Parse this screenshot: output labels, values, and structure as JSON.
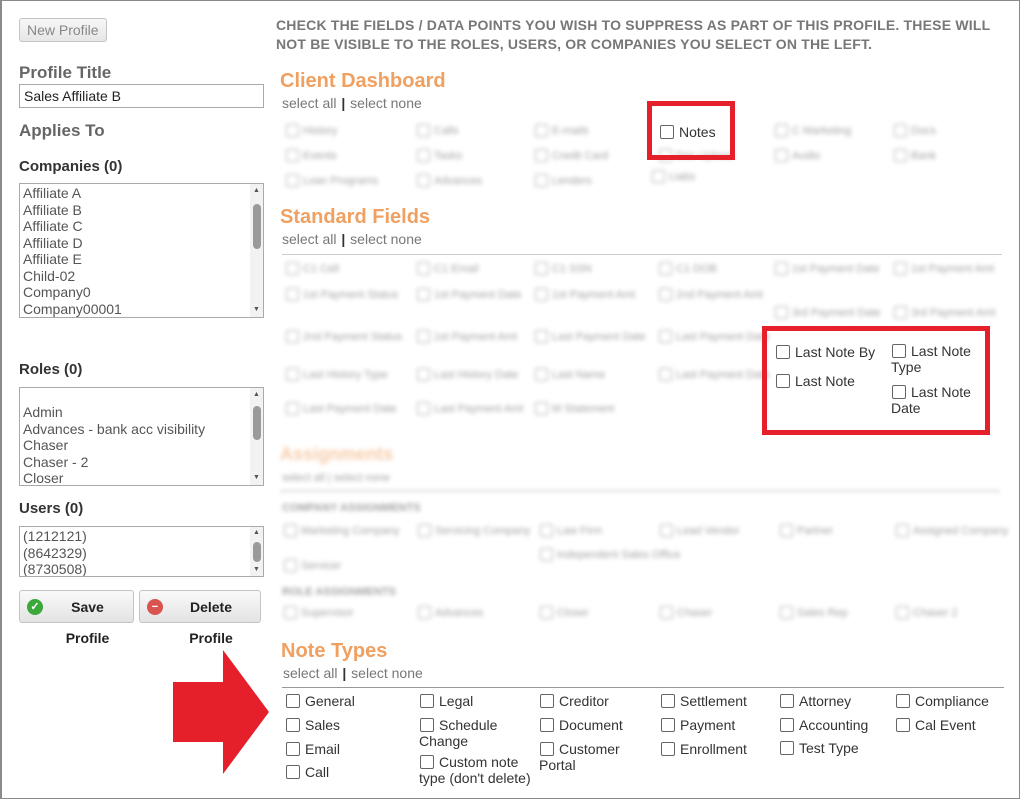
{
  "left": {
    "new_profile_label": "New Profile",
    "profile_title_label": "Profile Title",
    "profile_title_value": "Sales Affiliate B",
    "applies_to_label": "Applies To",
    "companies_label": "Companies (0)",
    "companies": [
      "Affiliate A",
      "Affiliate B",
      "Affiliate C",
      "Affiliate D",
      "Affiliate E",
      "Child-02",
      "Company0",
      "Company00001"
    ],
    "roles_label": "Roles (0)",
    "roles": [
      "Admin",
      "Advances - bank acc visibility",
      "Chaser",
      "Chaser - 2",
      "Closer"
    ],
    "users_label": "Users (0)",
    "users": [
      "(1212121)",
      "(8642329)",
      "(8730508)"
    ],
    "save_label": "Save Profile",
    "delete_label": "Delete Profile"
  },
  "instructions": "CHECK THE FIELDS / DATA POINTS YOU WISH TO SUPPRESS AS PART OF THIS PROFILE. THESE WILL NOT BE VISIBLE TO THE ROLES, USERS, OR COMPANIES YOU SELECT ON THE LEFT.",
  "select_all": "select all",
  "select_sep": "|",
  "select_none": "select none",
  "client_dashboard": {
    "title": "Client Dashboard",
    "notes_label": "Notes"
  },
  "standard_fields": {
    "title": "Standard Fields",
    "last_note_by": "Last Note By",
    "last_note": "Last Note",
    "last_note_type_1": "Last Note",
    "last_note_type_2": "Type",
    "last_note_date_1": "Last Note",
    "last_note_date_2": "Date"
  },
  "note_types": {
    "title": "Note Types",
    "items": {
      "general": "General",
      "sales": "Sales",
      "email": "Email",
      "call": "Call",
      "legal": "Legal",
      "schedule_1": "Schedule",
      "schedule_2": "Change",
      "custom_1": "Custom note",
      "custom_2": "type (don't delete)",
      "creditor": "Creditor",
      "document": "Document",
      "customer_1": "Customer",
      "customer_2": "Portal",
      "settlement": "Settlement",
      "payment": "Payment",
      "enrollment": "Enrollment",
      "attorney": "Attorney",
      "accounting": "Accounting",
      "test_type": "Test Type",
      "compliance": "Compliance",
      "cal_event": "Cal Event"
    }
  },
  "colors": {
    "section_title": "#f0a060",
    "highlight_red": "#e5202a",
    "save_icon": "#3aa83a",
    "delete_icon": "#d9534f"
  }
}
